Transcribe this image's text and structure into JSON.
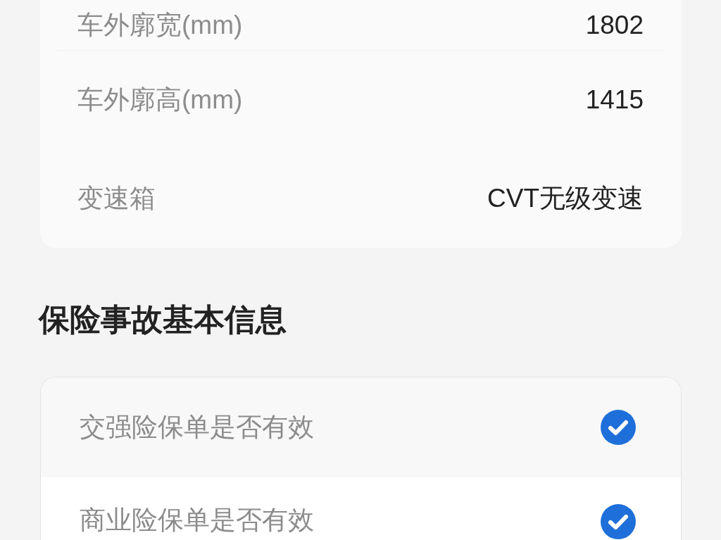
{
  "vehicle_specs": {
    "rows": [
      {
        "label": "车外廓宽(mm)",
        "value": "1802"
      },
      {
        "label": "车外廓高(mm)",
        "value": "1415"
      },
      {
        "label": "变速箱",
        "value": "CVT无级变速"
      }
    ]
  },
  "insurance_section": {
    "title": "保险事故基本信息",
    "rows": [
      {
        "label": "交强险保单是否有效",
        "checked": true
      },
      {
        "label": "商业险保单是否有效",
        "checked": true
      }
    ]
  }
}
